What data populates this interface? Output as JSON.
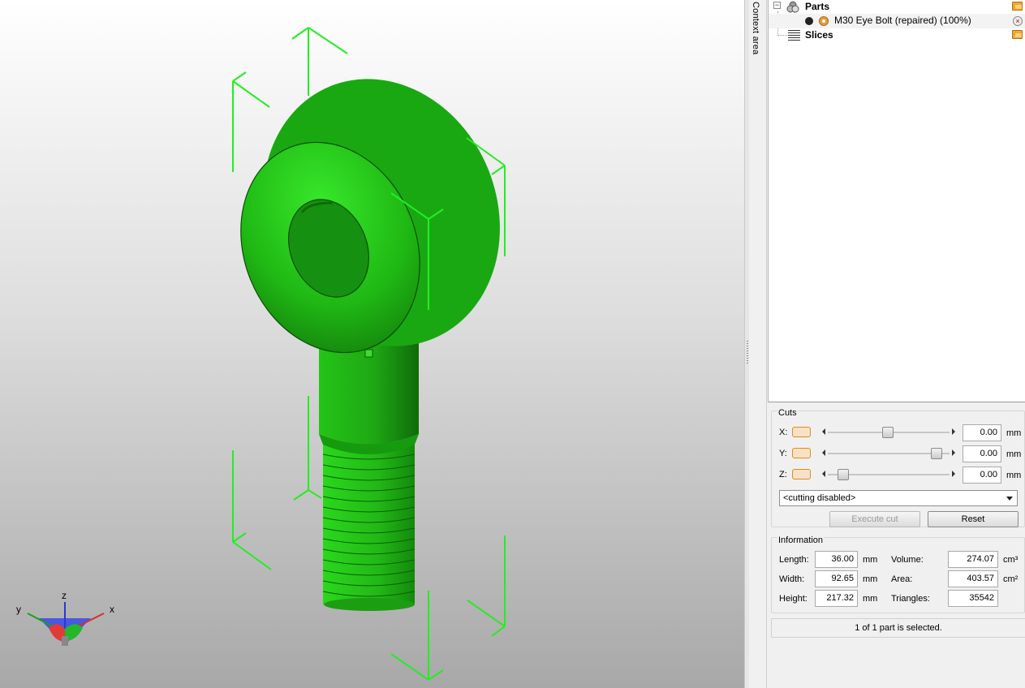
{
  "context_tab": {
    "label": "Context area"
  },
  "tree": {
    "parts_label": "Parts",
    "part_name": "M30 Eye Bolt (repaired) (100%)",
    "slices_label": "Slices",
    "expander_symbol": "−"
  },
  "cuts": {
    "title": "Cuts",
    "axes": [
      {
        "label": "X:",
        "value": "0.00",
        "unit": "mm",
        "slider_position": 0.5
      },
      {
        "label": "Y:",
        "value": "0.00",
        "unit": "mm",
        "slider_position": 0.96
      },
      {
        "label": "Z:",
        "value": "0.00",
        "unit": "mm",
        "slider_position": 0.12
      }
    ],
    "mode": "<cutting disabled>",
    "execute_label": "Execute cut",
    "reset_label": "Reset"
  },
  "information": {
    "title": "Information",
    "length_label": "Length:",
    "length_value": "36.00",
    "length_unit": "mm",
    "width_label": "Width:",
    "width_value": "92.65",
    "width_unit": "mm",
    "height_label": "Height:",
    "height_value": "217.32",
    "height_unit": "mm",
    "volume_label": "Volume:",
    "volume_value": "274.07",
    "volume_unit": "cm³",
    "area_label": "Area:",
    "area_value": "403.57",
    "area_unit": "cm²",
    "triangles_label": "Triangles:",
    "triangles_value": "35542"
  },
  "status": {
    "text": "1 of 1 part is selected."
  },
  "axis_gizmo": {
    "x": "x",
    "y": "y",
    "z": "z"
  },
  "colors": {
    "model": "#22cc11",
    "bbox": "#22ee22",
    "accent": "#e08a20"
  }
}
